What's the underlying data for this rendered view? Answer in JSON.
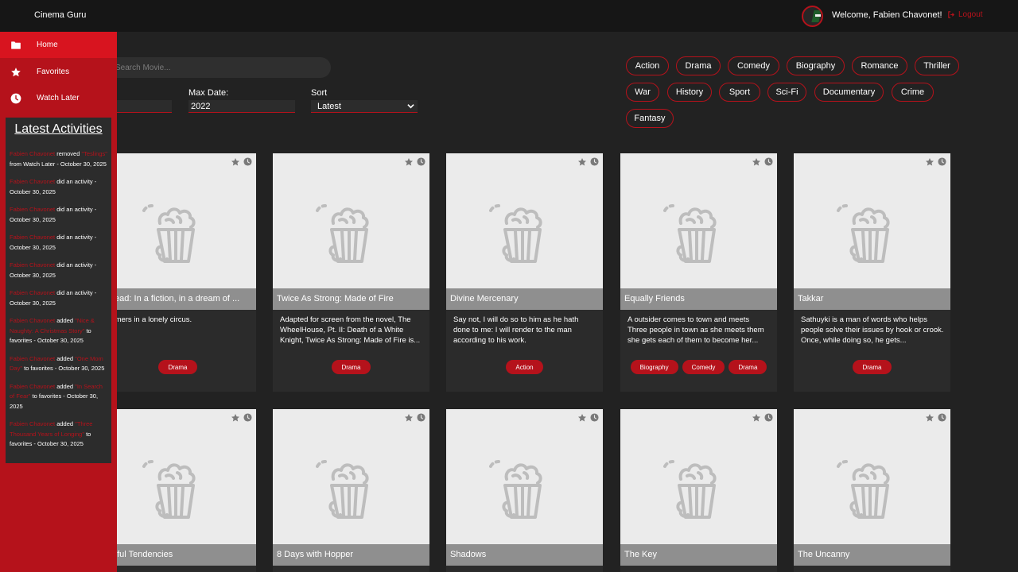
{
  "header": {
    "brand": "Cinema Guru",
    "welcome": "Welcome, Fabien Chavonet!",
    "logout": "Logout"
  },
  "sidebar": {
    "items": [
      {
        "label": "Home",
        "icon": "folder-icon"
      },
      {
        "label": "Favorites",
        "icon": "star-icon"
      },
      {
        "label": "Watch Later",
        "icon": "clock-icon"
      }
    ]
  },
  "activities": {
    "title": "Latest Activities",
    "items": [
      {
        "user": "Fabien Chavonet",
        "pre": " removed ",
        "movie": "\"Teslings\"",
        "post": " from Watch Later - October 30, 2025"
      },
      {
        "user": "Fabien Chavonet",
        "pre": " did an activity - October 30, 2025",
        "movie": "",
        "post": ""
      },
      {
        "user": "Fabien Chavonet",
        "pre": " did an activity - October 30, 2025",
        "movie": "",
        "post": ""
      },
      {
        "user": "Fabien Chavonet",
        "pre": " did an activity - October 30, 2025",
        "movie": "",
        "post": ""
      },
      {
        "user": "Fabien Chavonet",
        "pre": " did an activity - October 30, 2025",
        "movie": "",
        "post": ""
      },
      {
        "user": "Fabien Chavonet",
        "pre": " did an activity - October 30, 2025",
        "movie": "",
        "post": ""
      },
      {
        "user": "Fabien Chavonet",
        "pre": " added ",
        "movie": "\"Nice & Naughty: A Christmas Story\"",
        "post": " to favorites - October 30, 2025"
      },
      {
        "user": "Fabien Chavonet",
        "pre": " added ",
        "movie": "\"One Mom Day\"",
        "post": " to favorites - October 30, 2025"
      },
      {
        "user": "Fabien Chavonet",
        "pre": " added ",
        "movie": "\"In Search of Fear\"",
        "post": " to favorites - October 30, 2025"
      },
      {
        "user": "Fabien Chavonet",
        "pre": " added ",
        "movie": "\"Three Thousand Years of Longing\"",
        "post": " to favorites - October 30, 2025"
      }
    ]
  },
  "filters": {
    "search_placeholder": "Search Movie...",
    "max_date_label": "Max Date:",
    "max_date_value": "2022",
    "sort_label": "Sort",
    "sort_value": "Latest"
  },
  "genres": [
    "Action",
    "Drama",
    "Comedy",
    "Biography",
    "Romance",
    "Thriller",
    "War",
    "History",
    "Sport",
    "Sci-Fi",
    "Documentary",
    "Crime",
    "Fantasy"
  ],
  "movies_row1": [
    {
      "title": "dHead: In a fiction, in a dream of ...",
      "desc": "eamers in a lonely circus.",
      "tags": [
        "Drama"
      ]
    },
    {
      "title": "Twice As Strong: Made of Fire",
      "desc": "Adapted for screen from the novel, The WheelHouse, Pt. II: Death of a White Knight, Twice As Strong: Made of Fire is...",
      "tags": [
        "Drama"
      ]
    },
    {
      "title": "Divine Mercenary",
      "desc": "Say not, I will do so to him as he hath done to me: I will render to the man according to his work.",
      "tags": [
        "Action"
      ]
    },
    {
      "title": "Equally Friends",
      "desc": "A outsider comes to town and meets Three people in town as she meets them she gets each of them to become her...",
      "tags": [
        "Biography",
        "Comedy",
        "Drama"
      ]
    },
    {
      "title": "Takkar",
      "desc": "Sathuyki is a man of words who helps people solve their issues by hook or crook. Once, while doing so, he gets...",
      "tags": [
        "Drama"
      ]
    }
  ],
  "movies_row2": [
    {
      "title": "ceitful Tendencies"
    },
    {
      "title": "8 Days with Hopper"
    },
    {
      "title": "Shadows"
    },
    {
      "title": "The Key"
    },
    {
      "title": "The Uncanny"
    }
  ],
  "colors": {
    "accent": "#b5121b",
    "background": "#222222",
    "header": "#161616"
  }
}
